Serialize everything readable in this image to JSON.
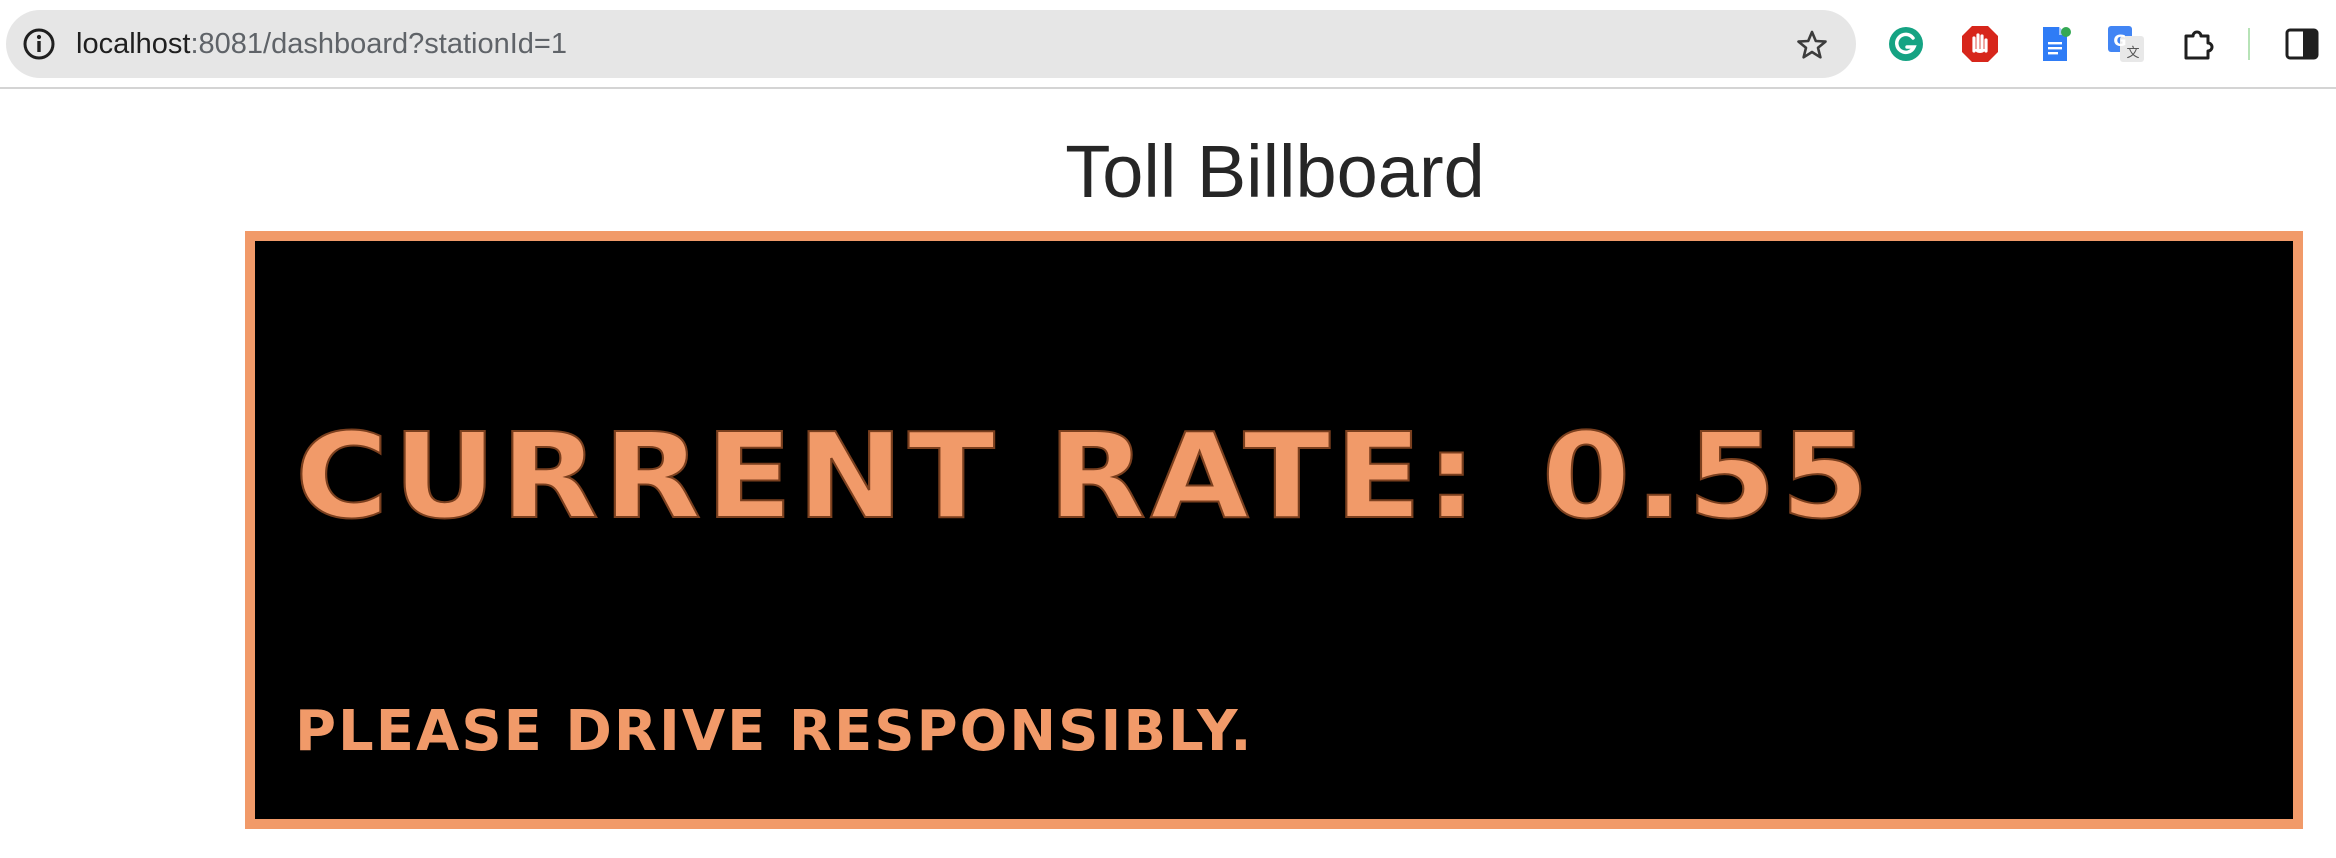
{
  "browser": {
    "url_host": "localhost",
    "url_rest": ":8081/dashboard?stationId=1",
    "icons": {
      "site_info": "info-icon",
      "bookmark": "star-icon",
      "extensions": [
        "grammarly-icon",
        "ad-block-icon",
        "google-docs-icon",
        "google-translate-icon",
        "puzzle-icon",
        "side-panel-icon"
      ]
    }
  },
  "page": {
    "title": "Toll Billboard",
    "billboard": {
      "rate_label": "CURRENT RATE:",
      "rate_value": "0.55",
      "message": "PLEASE DRIVE RESPONSIBLY."
    }
  },
  "colors": {
    "billboard_border": "#f19a69",
    "billboard_bg": "#000000",
    "billboard_text": "#f19a69"
  }
}
